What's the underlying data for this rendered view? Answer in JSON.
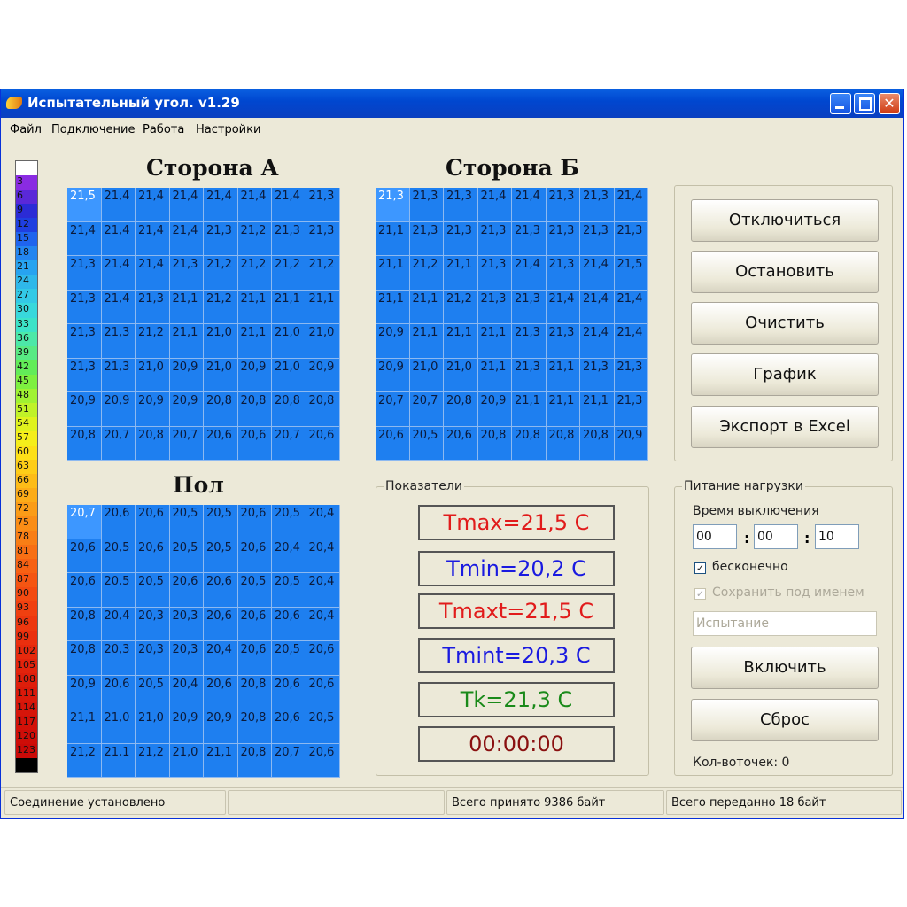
{
  "title": "Испытательный угол. v1.29",
  "menu": [
    "Файл",
    "Подключение",
    "Работа",
    "Настройки"
  ],
  "palette": {
    "labels": [
      "",
      "3",
      "6",
      "9",
      "12",
      "15",
      "18",
      "21",
      "24",
      "27",
      "30",
      "33",
      "36",
      "39",
      "42",
      "45",
      "48",
      "51",
      "54",
      "57",
      "60",
      "63",
      "66",
      "69",
      "72",
      "75",
      "78",
      "81",
      "84",
      "87",
      "90",
      "93",
      "96",
      "99",
      "102",
      "105",
      "108",
      "111",
      "114",
      "117",
      "120",
      "123",
      ""
    ],
    "colors": [
      "#ffffff",
      "#8a2be2",
      "#5a28d8",
      "#2b2bd6",
      "#1f3fe0",
      "#1f64ee",
      "#2385f0",
      "#27a3f0",
      "#2fb8ea",
      "#33c9e6",
      "#38d8dc",
      "#3ce3c8",
      "#4ce8a8",
      "#58ea84",
      "#62ec58",
      "#7ef040",
      "#a0f232",
      "#c0f228",
      "#e0f21e",
      "#f5ee1a",
      "#fde018",
      "#fecd18",
      "#fdbc18",
      "#fcac18",
      "#fb9c17",
      "#fa8d16",
      "#f97e15",
      "#f86f14",
      "#f76113",
      "#f55512",
      "#f34a11",
      "#f04010",
      "#ed370f",
      "#ea2f0e",
      "#e6290d",
      "#e2230c",
      "#de1e0b",
      "#da190a",
      "#d6150a",
      "#d21109",
      "#ce0d08",
      "#ca0a08",
      "#000000"
    ]
  },
  "sideA": {
    "title": "Сторона А",
    "cells": [
      [
        "21,5",
        "21,4",
        "21,4",
        "21,4",
        "21,4",
        "21,4",
        "21,4",
        "21,3"
      ],
      [
        "21,4",
        "21,4",
        "21,4",
        "21,4",
        "21,3",
        "21,2",
        "21,3",
        "21,3"
      ],
      [
        "21,3",
        "21,4",
        "21,4",
        "21,3",
        "21,2",
        "21,2",
        "21,2",
        "21,2"
      ],
      [
        "21,3",
        "21,4",
        "21,3",
        "21,1",
        "21,2",
        "21,1",
        "21,1",
        "21,1"
      ],
      [
        "21,3",
        "21,3",
        "21,2",
        "21,1",
        "21,0",
        "21,1",
        "21,0",
        "21,0"
      ],
      [
        "21,3",
        "21,3",
        "21,0",
        "20,9",
        "21,0",
        "20,9",
        "21,0",
        "20,9"
      ],
      [
        "20,9",
        "20,9",
        "20,9",
        "20,9",
        "20,8",
        "20,8",
        "20,8",
        "20,8"
      ],
      [
        "20,8",
        "20,7",
        "20,8",
        "20,7",
        "20,6",
        "20,6",
        "20,7",
        "20,6"
      ]
    ]
  },
  "sideB": {
    "title": "Сторона Б",
    "cells": [
      [
        "21,3",
        "21,3",
        "21,3",
        "21,4",
        "21,4",
        "21,3",
        "21,3",
        "21,4"
      ],
      [
        "21,1",
        "21,3",
        "21,3",
        "21,3",
        "21,3",
        "21,3",
        "21,3",
        "21,3"
      ],
      [
        "21,1",
        "21,2",
        "21,1",
        "21,3",
        "21,4",
        "21,3",
        "21,4",
        "21,5"
      ],
      [
        "21,1",
        "21,1",
        "21,2",
        "21,3",
        "21,3",
        "21,4",
        "21,4",
        "21,4"
      ],
      [
        "20,9",
        "21,1",
        "21,1",
        "21,1",
        "21,3",
        "21,3",
        "21,4",
        "21,4"
      ],
      [
        "20,9",
        "21,0",
        "21,0",
        "21,1",
        "21,3",
        "21,1",
        "21,3",
        "21,3"
      ],
      [
        "20,7",
        "20,7",
        "20,8",
        "20,9",
        "21,1",
        "21,1",
        "21,1",
        "21,3"
      ],
      [
        "20,6",
        "20,5",
        "20,6",
        "20,8",
        "20,8",
        "20,8",
        "20,8",
        "20,9"
      ]
    ]
  },
  "floor": {
    "title": "Пол",
    "cells": [
      [
        "20,7",
        "20,6",
        "20,6",
        "20,5",
        "20,5",
        "20,6",
        "20,5",
        "20,4"
      ],
      [
        "20,6",
        "20,5",
        "20,6",
        "20,5",
        "20,5",
        "20,6",
        "20,4",
        "20,4"
      ],
      [
        "20,6",
        "20,5",
        "20,5",
        "20,6",
        "20,6",
        "20,5",
        "20,5",
        "20,4"
      ],
      [
        "20,8",
        "20,4",
        "20,3",
        "20,3",
        "20,6",
        "20,6",
        "20,6",
        "20,4"
      ],
      [
        "20,8",
        "20,3",
        "20,3",
        "20,3",
        "20,4",
        "20,6",
        "20,5",
        "20,6"
      ],
      [
        "20,9",
        "20,6",
        "20,5",
        "20,4",
        "20,6",
        "20,8",
        "20,6",
        "20,6"
      ],
      [
        "21,1",
        "21,0",
        "21,0",
        "20,9",
        "20,9",
        "20,8",
        "20,6",
        "20,5"
      ],
      [
        "21,2",
        "21,1",
        "21,2",
        "21,0",
        "21,1",
        "20,8",
        "20,7",
        "20,6"
      ]
    ]
  },
  "buttons": {
    "disconnect": "Отключиться",
    "stop": "Остановить",
    "clear": "Очистить",
    "graph": "График",
    "export": "Экспорт в Excel"
  },
  "indicators": {
    "title": "Показатели",
    "tmax": "Tmax=21,5 C",
    "tmin": "Tmin=20,2 C",
    "tmaxt": "Tmaxt=21,5 C",
    "tmint": "Tmint=20,3 C",
    "tk": "Tk=21,3 C",
    "time": "00:00:00",
    "colors": {
      "red": "#e11b1b",
      "blue": "#1a1ae0",
      "green": "#1a8a1a",
      "darkred": "#8a1010"
    }
  },
  "power": {
    "title": "Питание нагрузки",
    "off_time_label": "Время выключения",
    "hours": "00",
    "minutes": "00",
    "seconds": "10",
    "colon": ":",
    "infinite_label": "бесконечно",
    "infinite_checked": true,
    "save_label": "Сохранить под именем",
    "save_checked": true,
    "name_placeholder": "Испытание",
    "on_button": "Включить",
    "reset_button": "Сброс",
    "count_label": "Кол-воточек: 0"
  },
  "status": {
    "connection": "Соединение установлено",
    "empty": "",
    "received": "Всего принято 9386 байт",
    "sent": "Всего переданно 18 байт"
  }
}
